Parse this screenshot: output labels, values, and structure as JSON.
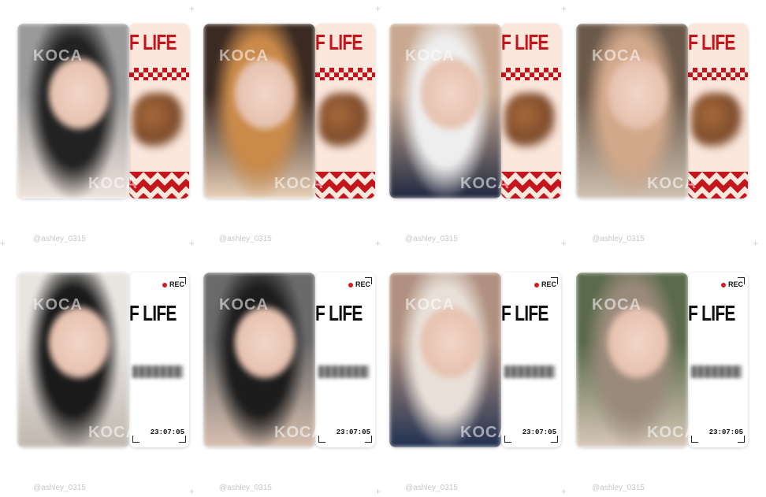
{
  "watermark": "KOCA",
  "handle": "@ashley_0315",
  "rows": [
    {
      "theme": "food",
      "title": "F LIFE",
      "cards": [
        {
          "name": "card-1",
          "colors": [
            "#9a9a9a",
            "#222",
            "#f0e4dc"
          ]
        },
        {
          "name": "card-2",
          "colors": [
            "#3a2a22",
            "#c98a4a",
            "#e8d0b8"
          ]
        },
        {
          "name": "card-3",
          "colors": [
            "#c8a890",
            "#eee",
            "#1f2840"
          ]
        },
        {
          "name": "card-4",
          "colors": [
            "#6b5a4a",
            "#d2a88a",
            "#cfc0b0"
          ]
        }
      ]
    },
    {
      "theme": "rec",
      "title": "F LIFE",
      "rec_label": "REC",
      "time": "23:07:05",
      "cards": [
        {
          "name": "card-5",
          "colors": [
            "#e8e4e0",
            "#1a1a1a",
            "#c0b8b0"
          ]
        },
        {
          "name": "card-6",
          "colors": [
            "#6a6a6a",
            "#1c1c1c",
            "#d8c0b0"
          ]
        },
        {
          "name": "card-7",
          "colors": [
            "#b09080",
            "#e8e0d8",
            "#203050"
          ]
        },
        {
          "name": "card-8",
          "colors": [
            "#5a6a4a",
            "#9a8a7a",
            "#d8c8b8"
          ]
        }
      ]
    }
  ]
}
